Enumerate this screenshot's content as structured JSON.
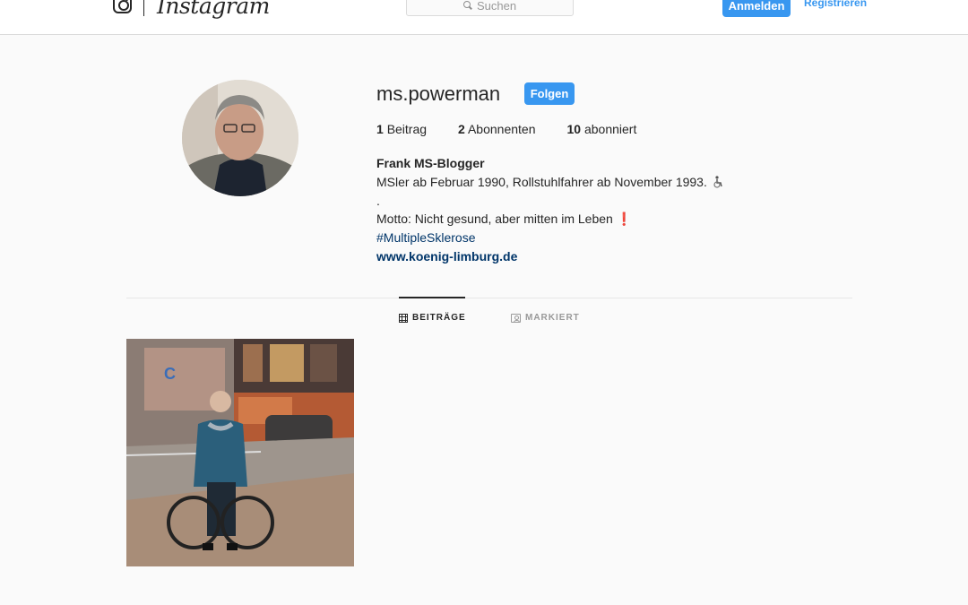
{
  "header": {
    "wordmark": "Instagram",
    "search_placeholder": "Suchen",
    "login_label": "Anmelden",
    "register_label": "Registrieren"
  },
  "profile": {
    "username": "ms.powerman",
    "follow_label": "Folgen",
    "stats": {
      "posts_count": "1",
      "posts_label": "Beitrag",
      "followers_count": "2",
      "followers_label": "Abonnenten",
      "following_count": "10",
      "following_label": "abonniert"
    },
    "bio": {
      "name": "Frank MS-Blogger",
      "line1": "MSler ab Februar 1990, Rollstuhlfahrer ab November 1993.",
      "line2": ".",
      "motto": "Motto: Nicht gesund, aber mitten im Leben",
      "motto_mark": "❗",
      "hashtag": "#MultipleSklerose",
      "link": "www.koenig-limburg.de"
    }
  },
  "tabs": {
    "posts_label": "BEITRÄGE",
    "tagged_label": "MARKIERT"
  },
  "colors": {
    "accent": "#3897f0",
    "link": "#003569",
    "text": "#262626",
    "muted": "#999999",
    "background": "#fafafa"
  },
  "icons": [
    "instagram-logo-icon",
    "search-icon",
    "wheelchair-icon",
    "exclamation-icon",
    "grid-icon",
    "tagged-user-icon"
  ]
}
